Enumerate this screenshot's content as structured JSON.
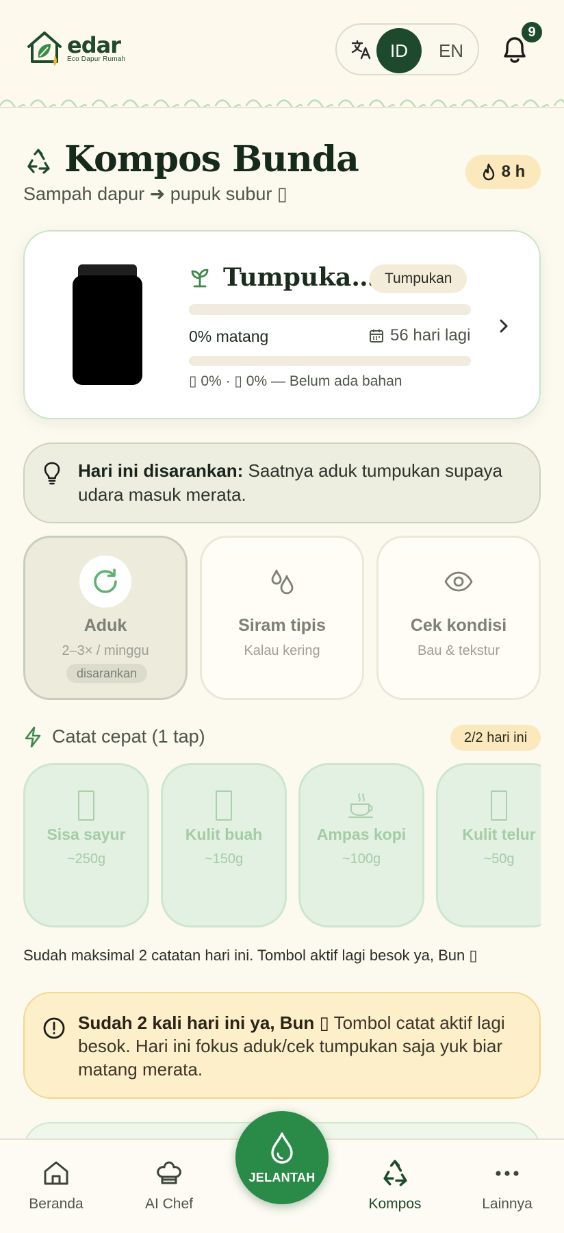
{
  "header": {
    "logo_word": "edar",
    "logo_tagline": "Eco Dapur Rumah",
    "lang_id": "ID",
    "lang_en": "EN",
    "active_lang": "ID",
    "notification_count": "9"
  },
  "page": {
    "title": "Kompos Bunda",
    "subtitle": "Sampah dapur ➜ pupuk subur ▯",
    "streak": "8 h"
  },
  "pile": {
    "name": "Tumpukan Kompos",
    "tag": "Tumpukan",
    "ripe_label": "0% matang",
    "ripe_percent": 0,
    "days_left": "56 hari lagi",
    "mix_percent": 0,
    "mix_label": "▯ 0% · ▯ 0% — Belum ada bahan"
  },
  "tip": {
    "lead": "Hari ini disarankan:",
    "text": " Saatnya aduk tumpukan supaya udara masuk merata."
  },
  "actions": [
    {
      "title": "Aduk",
      "sub": "2–3× / minggu",
      "badge": "disarankan",
      "icon": "refresh-icon"
    },
    {
      "title": "Siram tipis",
      "sub": "Kalau kering",
      "icon": "water-drops-icon"
    },
    {
      "title": "Cek kondisi",
      "sub": "Bau & tekstur",
      "icon": "eye-icon"
    }
  ],
  "quick_log": {
    "title": "Catat cepat (1 tap)",
    "count": "2/2 hari ini",
    "items": [
      {
        "name": "Sisa sayur",
        "weight": "~250g",
        "icon": "vegetable-icon"
      },
      {
        "name": "Kulit buah",
        "weight": "~150g",
        "icon": "fruit-icon"
      },
      {
        "name": "Ampas kopi",
        "weight": "~100g",
        "icon": "coffee-icon"
      },
      {
        "name": "Kulit telur",
        "weight": "~50g",
        "icon": "egg-icon"
      }
    ],
    "note": "Sudah maksimal 2 catatan hari ini. Tombol aktif lagi besok ya, Bun ▯"
  },
  "warning": {
    "lead": "Sudah 2 kali hari ini ya, Bun ▯",
    "text": " Tombol catat aktif lagi besok. Hari ini fokus aduk/cek tumpukan saja yuk biar matang merata."
  },
  "nav": {
    "items": [
      {
        "label": "Beranda",
        "icon": "home-icon"
      },
      {
        "label": "AI Chef",
        "icon": "chef-hat-icon"
      },
      {
        "label": "Kompos",
        "icon": "recycle-icon",
        "active": true
      },
      {
        "label": "Lainnya",
        "icon": "more-icon"
      }
    ],
    "fab_label": "JELANTAH"
  },
  "colors": {
    "primary": "#1d4a2d",
    "accent_green": "#2a8a47",
    "background": "#fcf9ef",
    "warn_bg": "#fcefc9",
    "streak_bg": "#fbe9bd"
  }
}
